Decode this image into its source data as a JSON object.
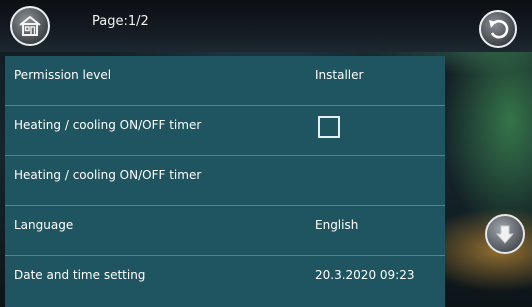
{
  "header": {
    "page_label": "Page:1/2",
    "home_icon": "home-icon",
    "back_icon": "back-arrow-icon"
  },
  "settings": [
    {
      "label": "Permission level",
      "value": "Installer",
      "type": "text"
    },
    {
      "label": "Heating / cooling ON/OFF timer",
      "value": "",
      "type": "checkbox",
      "checked": false
    },
    {
      "label": "Heating / cooling ON/OFF timer",
      "value": "",
      "type": "text"
    },
    {
      "label": "Language",
      "value": "English",
      "type": "text"
    },
    {
      "label": "Date and time setting",
      "value": "20.3.2020 09:23",
      "type": "text"
    }
  ],
  "scroll": {
    "icon": "scroll-down-icon"
  },
  "colors": {
    "panel": "#1f5561",
    "header": "#141b22",
    "text": "#ffffff"
  }
}
